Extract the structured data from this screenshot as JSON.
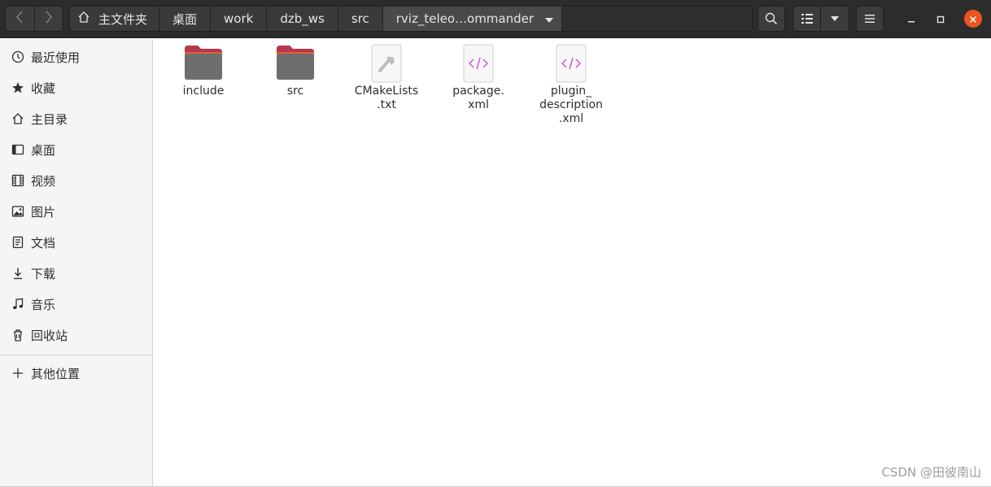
{
  "header": {
    "back_icon": "chevron-left-icon",
    "forward_icon": "chevron-right-icon",
    "breadcrumbs": [
      "主文件夹",
      "桌面",
      "work",
      "dzb_ws",
      "src",
      "rviz_teleo…ommander"
    ],
    "search_icon": "search-icon",
    "view_icon": "list-view-icon",
    "view_dropdown_icon": "chevron-down-icon",
    "menu_icon": "hamburger-menu-icon",
    "window_controls": [
      "minimize",
      "maximize",
      "close"
    ],
    "close_color": "#e95420"
  },
  "sidebar": {
    "items": [
      {
        "label": "最近使用",
        "icon": "clock-icon"
      },
      {
        "label": "收藏",
        "icon": "star-icon"
      },
      {
        "label": "主目录",
        "icon": "home-icon"
      },
      {
        "label": "桌面",
        "icon": "desktop-icon"
      },
      {
        "label": "视频",
        "icon": "video-icon"
      },
      {
        "label": "图片",
        "icon": "image-icon"
      },
      {
        "label": "文档",
        "icon": "document-icon"
      },
      {
        "label": "下载",
        "icon": "download-icon"
      },
      {
        "label": "音乐",
        "icon": "music-icon"
      },
      {
        "label": "回收站",
        "icon": "trash-icon"
      }
    ],
    "other": {
      "label": "其他位置",
      "icon": "plus-icon"
    }
  },
  "files": [
    {
      "name_lines": [
        "include"
      ],
      "type": "folder"
    },
    {
      "name_lines": [
        "src"
      ],
      "type": "folder"
    },
    {
      "name_lines": [
        "CMakeLists",
        ".txt"
      ],
      "type": "cmake-file"
    },
    {
      "name_lines": [
        "package.",
        "xml"
      ],
      "type": "xml-file"
    },
    {
      "name_lines": [
        "plugin_",
        "description",
        ".xml"
      ],
      "type": "xml-file"
    }
  ],
  "folder_accent": "#c7403a",
  "watermark": "CSDN @田彼南山"
}
